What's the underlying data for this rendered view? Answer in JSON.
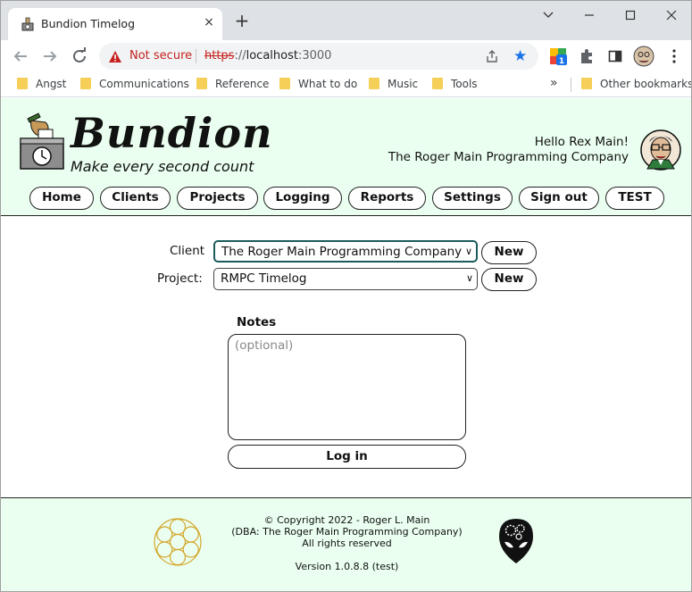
{
  "browser": {
    "tab_title": "Bundion Timelog",
    "tab_close": "×",
    "new_tab": "+",
    "security_label": "Not secure",
    "url_scheme": "https",
    "url_sep": "://",
    "url_host": "localhost",
    "url_port": ":3000",
    "extension_badge": "1",
    "bookmarks": [
      "Angst",
      "Communications",
      "Reference",
      "What to do",
      "Music",
      "Tools"
    ],
    "bookmarks_more": "»",
    "other_bookmarks": "Other bookmarks"
  },
  "app": {
    "logo_text": "Bundion",
    "tagline": "Make every second count",
    "greeting": "Hello Rex Main!",
    "company": "The Roger Main Programming Company",
    "nav": [
      "Home",
      "Clients",
      "Projects",
      "Logging",
      "Reports",
      "Settings",
      "Sign out",
      "TEST"
    ]
  },
  "form": {
    "client_label": "Client",
    "client_value": "The Roger Main Programming Company",
    "project_label": "Project:",
    "project_value": "RMPC Timelog",
    "new_label": "New",
    "notes_label": "Notes",
    "notes_placeholder": "(optional)",
    "login_label": "Log in"
  },
  "footer": {
    "copyright": "© Copyright 2022 - Roger L. Main",
    "dba": "(DBA: The Roger Main Programming Company)",
    "rights": "All rights reserved",
    "version": "Version 1.0.8.8 (test)"
  },
  "colors": {
    "header_bg": "#eafff0",
    "not_secure": "#c5221f",
    "star": "#1a73e8",
    "folder": "#f5cf57"
  }
}
